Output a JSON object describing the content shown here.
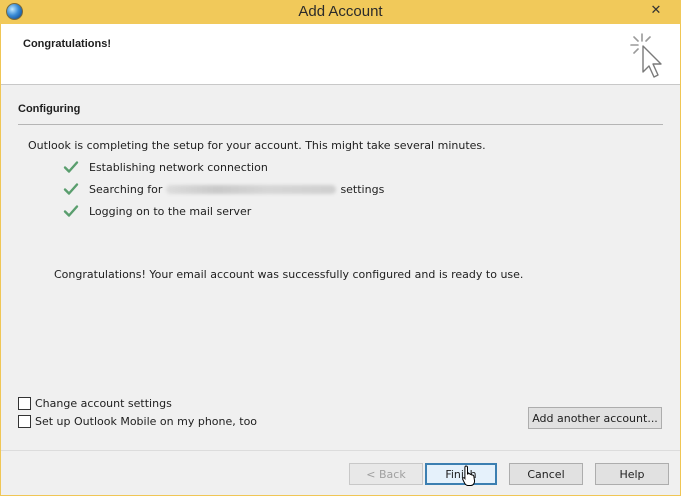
{
  "window": {
    "title": "Add Account",
    "close_glyph": "✕"
  },
  "header": {
    "title": "Congratulations!",
    "icon": "sparkle-cursor-icon"
  },
  "section": {
    "title": "Configuring"
  },
  "intro_text": "Outlook is completing the setup for your account. This might take several minutes.",
  "steps": [
    {
      "label": "Establishing network connection",
      "status": "done"
    },
    {
      "label_before": "Searching for",
      "label_after": "settings",
      "status": "done"
    },
    {
      "label": "Logging on to the mail server",
      "status": "done"
    }
  ],
  "success_message": "Congratulations! Your email account was successfully configured and is ready to use.",
  "options": {
    "change_settings": {
      "label": "Change account settings",
      "checked": false
    },
    "outlook_mobile": {
      "label": "Set up Outlook Mobile on my phone, too",
      "checked": false
    }
  },
  "buttons": {
    "add_another": "Add another account...",
    "back": "< Back",
    "finish": "Finish",
    "cancel": "Cancel",
    "help": "Help"
  },
  "colors": {
    "titlebar": "#f1c95a",
    "check": "#5a9e6e",
    "default_button_border": "#3c7fb1"
  }
}
